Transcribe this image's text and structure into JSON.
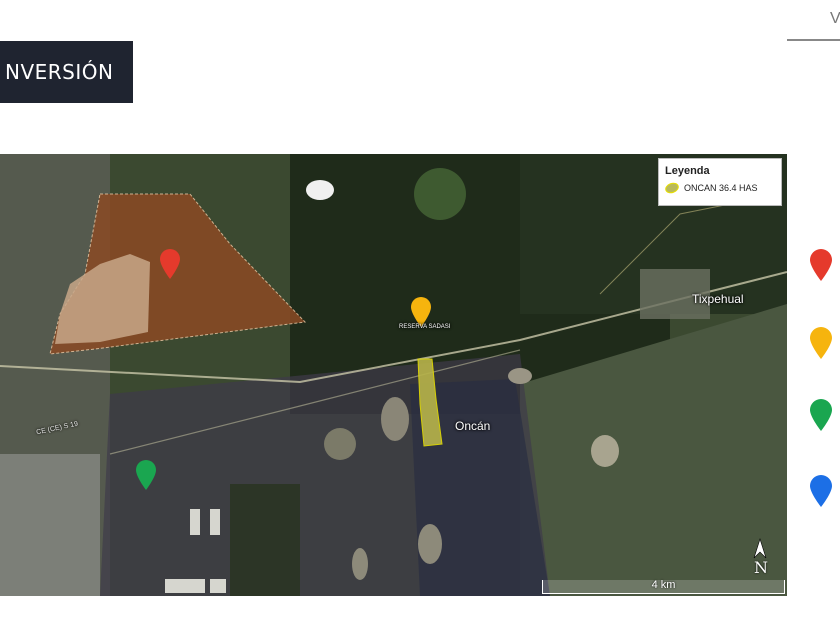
{
  "header": {
    "title": "NVERSIÓN",
    "top_right_fragment": "V"
  },
  "map": {
    "legend": {
      "title": "Leyenda",
      "entry": "ONCAN 36.4 HAS",
      "swatch_color": "#e8e000"
    },
    "labels": {
      "town_tixpehual": "Tixpehual",
      "town_oncan": "Oncán",
      "reserva": "RESERVA SADASI",
      "road": "CE (CE) S 19"
    },
    "scale_label": "4 km",
    "north_label": "N",
    "markers": [
      {
        "name": "red-marker",
        "color": "#e53a2c"
      },
      {
        "name": "yellow-marker",
        "color": "#f6b40e"
      },
      {
        "name": "green-marker",
        "color": "#1aa650"
      }
    ]
  },
  "side_legend": {
    "markers": [
      {
        "name": "red",
        "color": "#e53a2c"
      },
      {
        "name": "yellow",
        "color": "#f6b40e"
      },
      {
        "name": "green",
        "color": "#1aa650"
      },
      {
        "name": "blue",
        "color": "#1c6fe6"
      }
    ]
  }
}
